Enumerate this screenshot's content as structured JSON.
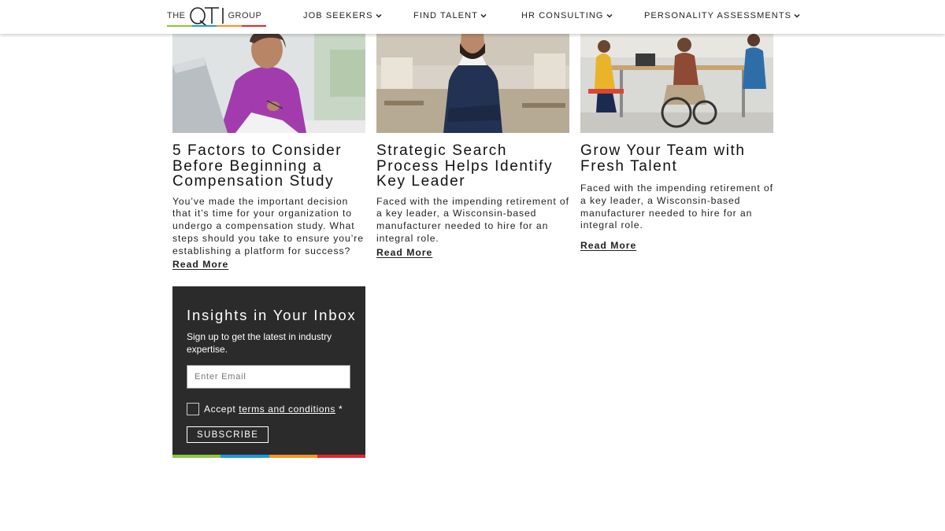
{
  "header": {
    "logo": {
      "the": "THE",
      "qti": "QTI",
      "group": "GROUP"
    },
    "nav": [
      {
        "label": "JOB SEEKERS"
      },
      {
        "label": "FIND TALENT"
      },
      {
        "label": "HR CONSULTING"
      },
      {
        "label": "PERSONALITY ASSESSMENTS"
      }
    ]
  },
  "brand_colors": [
    "#8dc63f",
    "#1e9ad6",
    "#f7941d",
    "#e2262e"
  ],
  "articles": [
    {
      "title": "5 Factors to Consider Before Beginning a Compensation Study",
      "excerpt": "You’ve made the important decision that it’s time for your organization to undergo a compensation study. What steps should you take to ensure you’re establishing a platform for success?",
      "read_more": "Read More"
    },
    {
      "title": "Strategic Search Process Helps Identify Key Leader",
      "excerpt": "Faced with the impending retirement of a key leader, a Wisconsin-based manufacturer needed to hire for an integral role.",
      "read_more": "Read More"
    },
    {
      "title": "Grow Your Team with Fresh Talent",
      "excerpt": "Faced with the impending retirement of a key leader, a Wisconsin-based manufacturer needed to hire for an integral role.",
      "read_more": "Read More"
    }
  ],
  "newsletter": {
    "title": "Insights in Your Inbox",
    "subtitle": "Sign up to get the latest in industry expertise.",
    "email_placeholder": "Enter Email",
    "consent_prefix": "Accept",
    "consent_link": "terms and conditions",
    "consent_suffix": "*",
    "subscribe_label": "SUBSCRIBE"
  }
}
